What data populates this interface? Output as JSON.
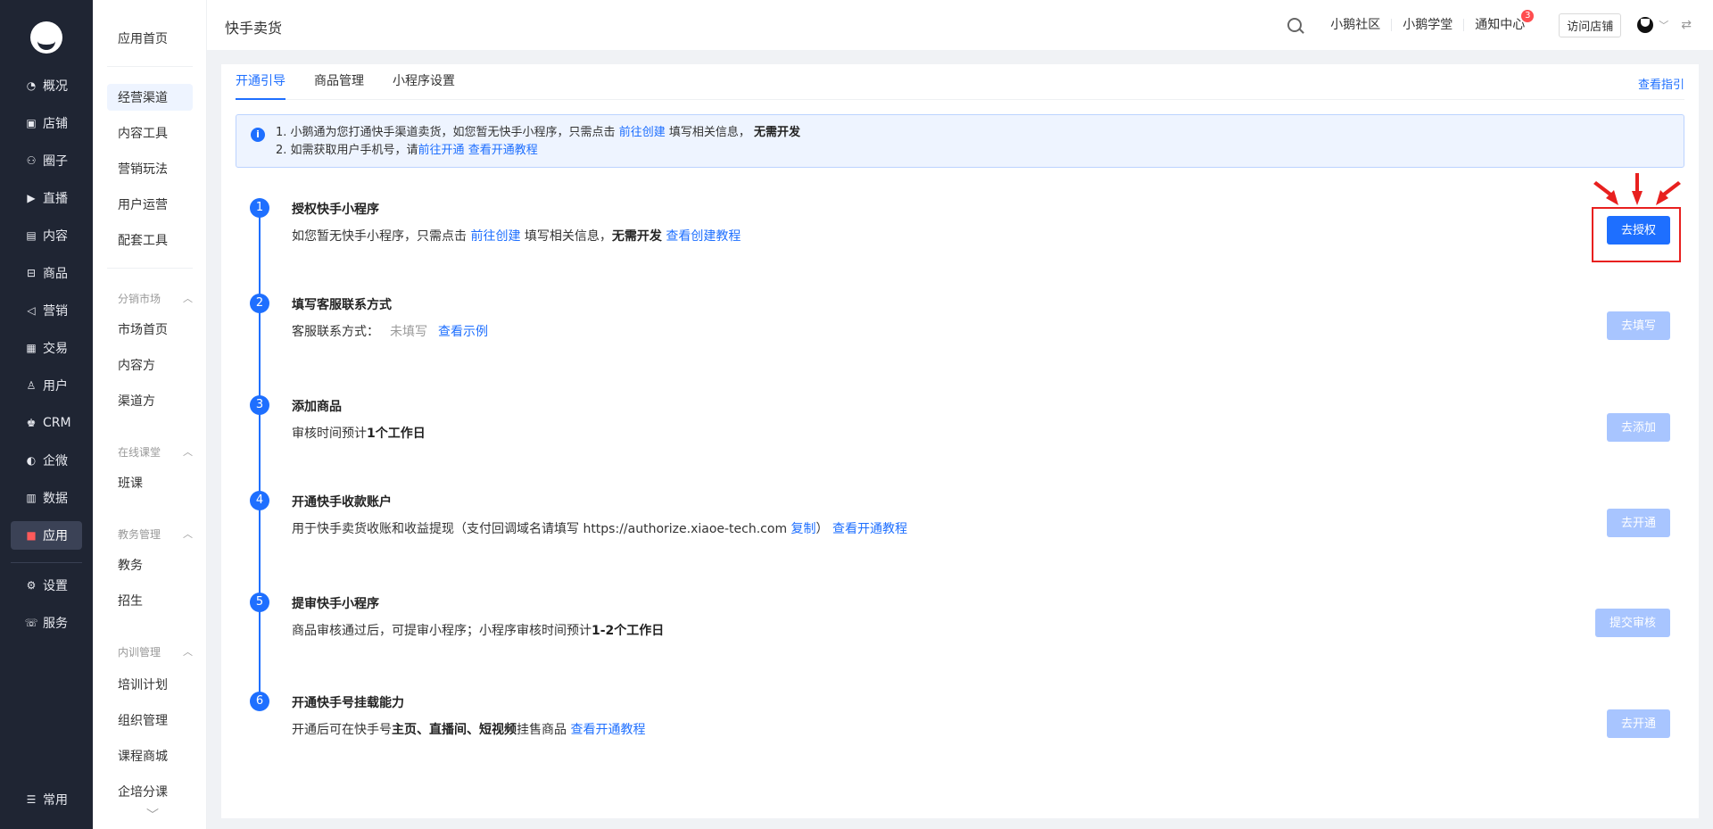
{
  "nav": {
    "items": [
      {
        "label": "概况",
        "icon": "◔"
      },
      {
        "label": "店铺",
        "icon": "▣"
      },
      {
        "label": "圈子",
        "icon": "⚇"
      },
      {
        "label": "直播",
        "icon": "▶"
      },
      {
        "label": "内容",
        "icon": "▤"
      },
      {
        "label": "商品",
        "icon": "⊟"
      },
      {
        "label": "营销",
        "icon": "◁"
      },
      {
        "label": "交易",
        "icon": "▦"
      },
      {
        "label": "用户",
        "icon": "♙"
      },
      {
        "label": "CRM",
        "icon": "♚"
      },
      {
        "label": "企微",
        "icon": "◐"
      },
      {
        "label": "数据",
        "icon": "▥"
      },
      {
        "label": "应用",
        "icon": "■"
      },
      {
        "label": "设置",
        "icon": "⚙"
      },
      {
        "label": "服务",
        "icon": "☏"
      },
      {
        "label": "常用",
        "icon": "☰"
      }
    ]
  },
  "subnav": {
    "home": "应用首页",
    "items": [
      "经营渠道",
      "内容工具",
      "营销玩法",
      "用户运营",
      "配套工具"
    ],
    "groups": [
      {
        "title": "分销市场",
        "items": [
          "市场首页",
          "内容方",
          "渠道方"
        ]
      },
      {
        "title": "在线课堂",
        "items": [
          "班课"
        ]
      },
      {
        "title": "教务管理",
        "items": [
          "教务",
          "招生"
        ]
      },
      {
        "title": "内训管理",
        "items": [
          "培训计划",
          "组织管理",
          "课程商城",
          "企培分课"
        ]
      }
    ]
  },
  "topbar": {
    "title": "快手卖货",
    "links": [
      "小鹅社区",
      "小鹅学堂",
      "通知中心"
    ],
    "notify_count": "3",
    "visit_store": "访问店铺"
  },
  "tabs": [
    "开通引导",
    "商品管理",
    "小程序设置"
  ],
  "guide_link": "查看指引",
  "notice": {
    "line1_pre": "1. 小鹅通为您打通快手渠道卖货，如您暂无快手小程序，只需点击",
    "line1_link": "前往创建",
    "line1_mid": "填写相关信息，",
    "line1_bold": "无需开发",
    "line2_pre": "2. 如需获取用户手机号，请",
    "line2_link1": "前往开通",
    "line2_link2": "查看开通教程"
  },
  "steps": [
    {
      "num": "1",
      "title": "授权快手小程序",
      "button": "去授权"
    },
    {
      "num": "2",
      "title": "填写客服联系方式",
      "button": "去填写"
    },
    {
      "num": "3",
      "title": "添加商品",
      "button": "去添加"
    },
    {
      "num": "4",
      "title": "开通快手收款账户",
      "button": "去开通"
    },
    {
      "num": "5",
      "title": "提审快手小程序",
      "button": "提交审核"
    },
    {
      "num": "6",
      "title": "开通快手号挂载能力",
      "button": "去开通"
    }
  ],
  "step_desc": {
    "s1_pre": "如您暂无快手小程序，只需点击",
    "s1_link": "前往创建",
    "s1_mid": "填写相关信息，",
    "s1_bold": "无需开发",
    "s1_link2": "查看创建教程",
    "s2_label": "客服联系方式：",
    "s2_value": "未填写",
    "s2_link": "查看示例",
    "s3_pre": "审核时间预计",
    "s3_bold": "1个工作日",
    "s4_pre": "用于快手卖货收账和收益提现（支付回调域名请填写 https://authorize.xiaoe-tech.com",
    "s4_copy": "复制",
    "s4_post": "）",
    "s4_link": "查看开通教程",
    "s5_pre": "商品审核通过后，可提审小程序；小程序审核时间预计",
    "s5_bold": "1-2个工作日",
    "s6_pre": "开通后可在快手号",
    "s6_bold": "主页、直播间、短视频",
    "s6_post": "挂售商品",
    "s6_link": "查看开通教程"
  }
}
